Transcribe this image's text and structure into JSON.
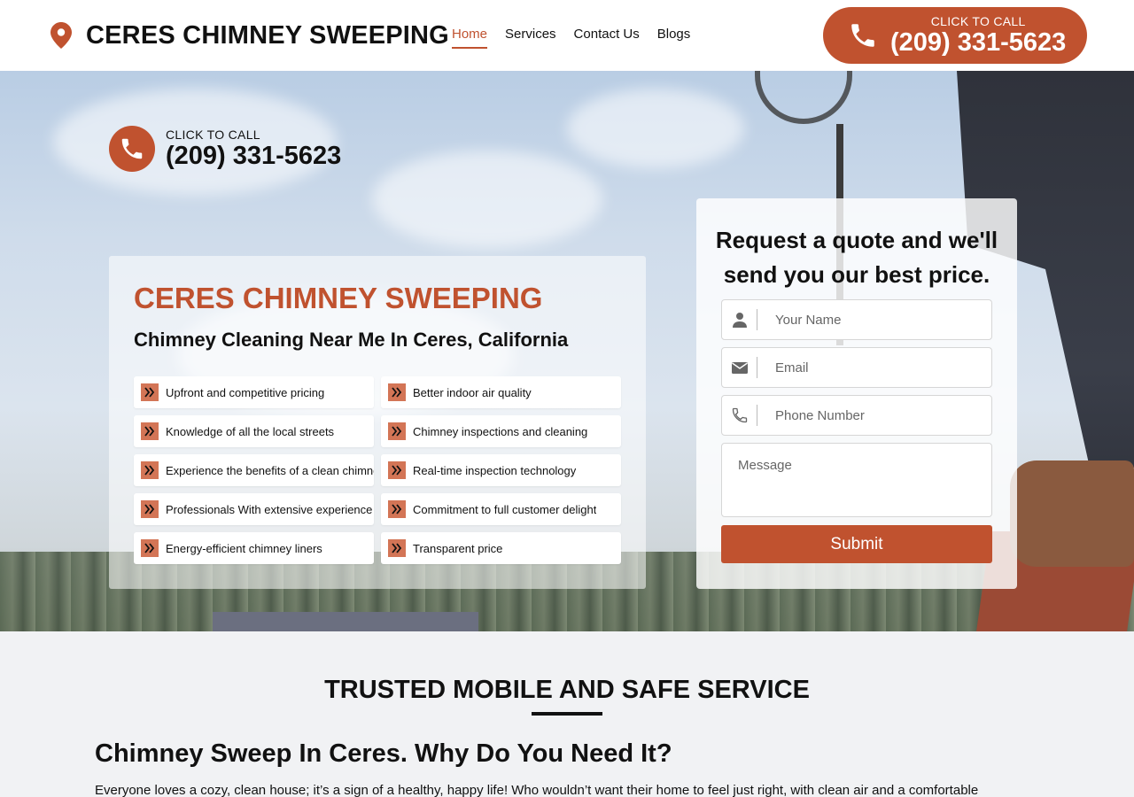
{
  "header": {
    "logo_icon": "map-pin-icon",
    "logo_text": "CERES CHIMNEY SWEEPING",
    "nav": [
      {
        "label": "Home",
        "active": true
      },
      {
        "label": "Services",
        "active": false
      },
      {
        "label": "Contact Us",
        "active": false
      },
      {
        "label": "Blogs",
        "active": false
      }
    ],
    "call": {
      "icon": "phone-icon",
      "small": "CLICK TO CALL",
      "number": "(209) 331-5623"
    }
  },
  "hero": {
    "call": {
      "icon": "phone-icon",
      "small": "CLICK TO CALL",
      "number": "(209) 331-5623"
    },
    "title": "CERES CHIMNEY SWEEPING",
    "subtitle": "Chimney Cleaning Near Me In Ceres, California",
    "features_left": [
      "Upfront and competitive pricing",
      "Knowledge of all the local streets",
      "Experience the benefits of a clean chimney",
      "Professionals With extensive experience",
      "Energy-efficient chimney liners"
    ],
    "features_right": [
      "Better indoor air quality",
      "Chimney inspections and cleaning",
      "Real-time inspection technology",
      "Commitment to full customer delight",
      "Transparent price"
    ]
  },
  "form": {
    "title_line1": "Request a quote and we'll",
    "title_line2": "send you our best price.",
    "name_placeholder": "Your Name",
    "email_placeholder": "Email",
    "phone_placeholder": "Phone Number",
    "message_placeholder": "Message",
    "submit_label": "Submit"
  },
  "section": {
    "title": "TRUSTED MOBILE AND SAFE SERVICE",
    "heading": "Chimney Sweep In Ceres. Why Do You Need It?",
    "paragraph": "Everyone loves a cozy, clean house; it’s a sign of a healthy, happy life! Who wouldn’t want their home to feel just right, with clean air and a comfortable"
  },
  "colors": {
    "accent": "#c0522f",
    "badge": "#d37556"
  }
}
